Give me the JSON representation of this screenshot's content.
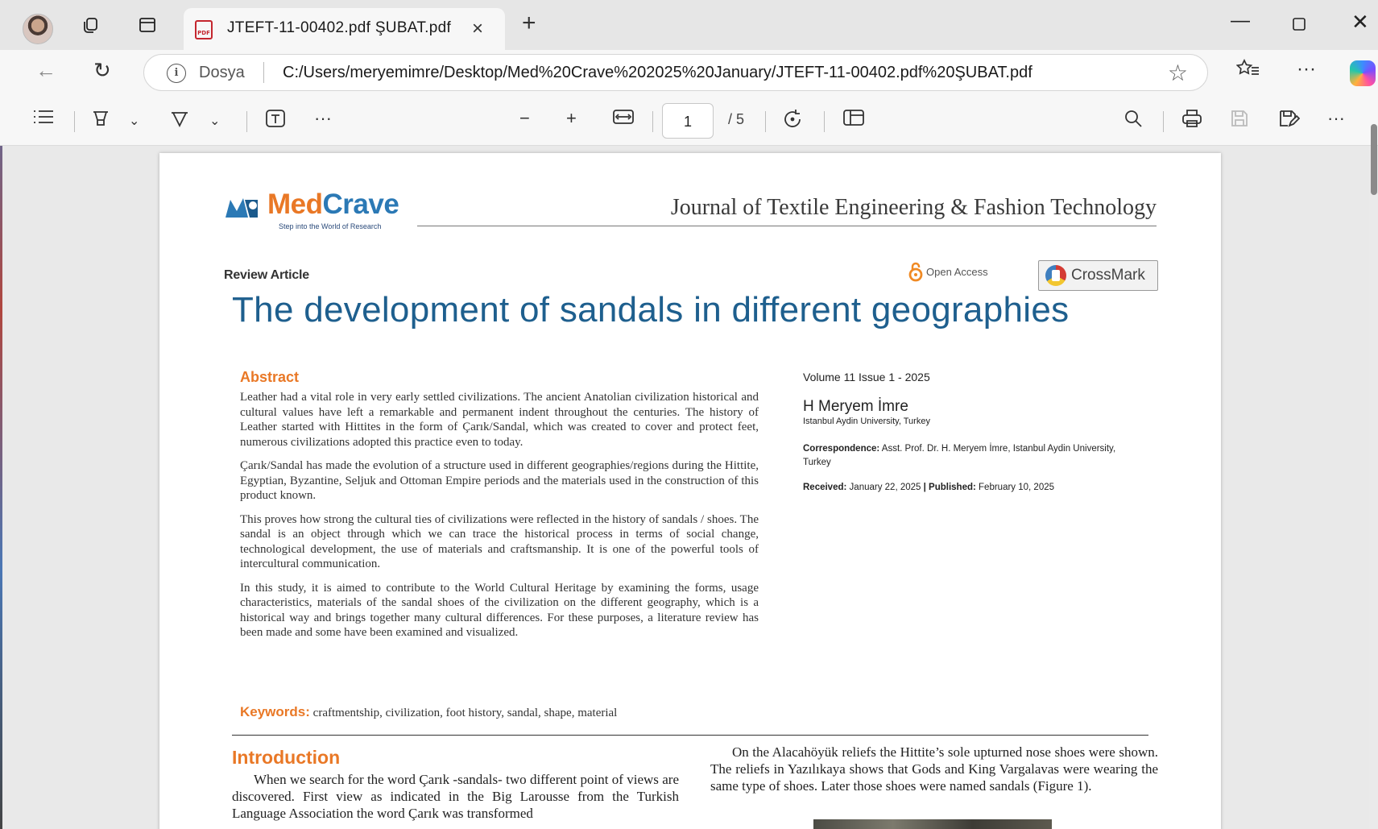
{
  "tab": {
    "title": "JTEFT-11-00402.pdf ŞUBAT.pdf",
    "file_icon": "pdf-file-icon",
    "close": "×"
  },
  "address": {
    "site_label": "Dosya",
    "url": "C:/Users/meryemimre/Desktop/Med%20Crave%202025%20January/JTEFT-11-00402.pdf%20ŞUBAT.pdf"
  },
  "pdf_toolbar": {
    "current_page": "1",
    "total_pages": "/ 5"
  },
  "doc": {
    "logo_name_a": "Med",
    "logo_name_b": "Crave",
    "logo_tagline": "Step into the World of Research",
    "journal": "Journal of Textile Engineering & Fashion Technology",
    "article_type": "Review Article",
    "open_access": "Open Access",
    "crossmark": "CrossMark",
    "title": "The development of sandals in different geographies",
    "abstract_heading": "Abstract",
    "abstract": [
      "Leather had a vital role in very early settled civilizations. The ancient Anatolian civilization historical and cultural values have left a remarkable and permanent indent throughout the centuries. The history of Leather started with Hittites in the form of Çarık/Sandal, which was created to cover and protect feet, numerous civilizations adopted this practice even to today.",
      "Çarık/Sandal has made the evolution of a structure used in different geographies/regions during the Hittite, Egyptian, Byzantine, Seljuk and Ottoman Empire periods and the materials used in the construction of this product known.",
      "This proves how strong the cultural ties of civilizations were reflected in the history of sandals / shoes. The sandal is an object through which we can trace the historical process in terms of social change, technological development, the use of materials and craftsmanship. It is one of the powerful tools of intercultural communication.",
      "In this study, it is aimed to contribute to the World Cultural Heritage by examining the forms, usage characteristics, materials of the sandal shoes of the civilization on the different geography, which is a historical way and brings together many cultural differences. For these purposes, a literature review has been made and some have been examined and visualized."
    ],
    "keywords_label": "Keywords:",
    "keywords": "craftmentship, civilization, foot history, sandal, shape, material",
    "volume": "Volume 11 Issue 1 - 2025",
    "author": "H Meryem İmre",
    "affiliation": "Istanbul Aydin University, Turkey",
    "corr_label": "Correspondence:",
    "corr_text": "Asst. Prof. Dr. H. Meryem İmre, Istanbul Aydin University, Turkey",
    "received_label": "Received:",
    "received": "January 22, 2025",
    "date_sep": "|",
    "published_label": "Published:",
    "published": "February 10, 2025",
    "intro_heading": "Introduction",
    "intro_left": "When we search for the word Çarık -sandals- two different point of views are discovered. First view as indicated in the Big Larousse from the Turkish Language Association the word Çarık was transformed",
    "intro_right": "On the Alacahöyük reliefs the Hittite’s sole upturned nose shoes were shown. The reliefs in Yazılıkaya shows that Gods and King Vargalavas were wearing the same type of shoes. Later those shoes were named sandals (Figure 1)."
  }
}
